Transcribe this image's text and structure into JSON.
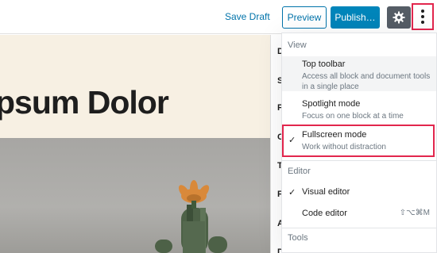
{
  "toolbar": {
    "save_draft": "Save Draft",
    "preview": "Preview",
    "publish": "Publish…",
    "settings_icon": "gear-icon",
    "more_icon": "vertical-ellipsis-icon",
    "accent": "#0085ba",
    "highlight": "#e2264d"
  },
  "canvas": {
    "hero_title": "psum Dolor"
  },
  "sidebar": {
    "letters": [
      "D",
      "S",
      "P",
      "C",
      "T",
      "F",
      "A",
      "D"
    ]
  },
  "menu": {
    "view_label": "View",
    "top_toolbar": {
      "title": "Top toolbar",
      "desc": "Access all block and document tools in a single place"
    },
    "spotlight": {
      "title": "Spotlight mode",
      "desc": "Focus on one block at a time"
    },
    "fullscreen": {
      "title": "Fullscreen mode",
      "desc": "Work without distraction",
      "check": "✓"
    },
    "editor_label": "Editor",
    "visual_editor": {
      "title": "Visual editor",
      "check": "✓"
    },
    "code_editor": {
      "title": "Code editor",
      "shortcut": "⇧⌥⌘M"
    },
    "tools_label": "Tools"
  }
}
